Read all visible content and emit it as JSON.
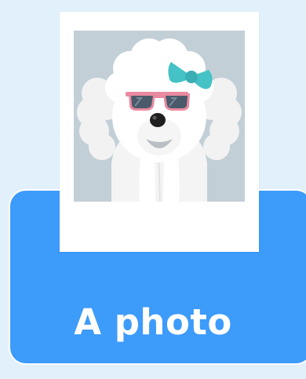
{
  "caption": "A photo",
  "photo": {
    "subject_icon": "poodle-with-sunglasses-and-bow-icon"
  },
  "colors": {
    "page_background": "#e1f0fa",
    "card_background": "#3d9bfa",
    "photo_background": "#c3cfd7",
    "bow": "#45c2c6",
    "sunglasses_frame": "#e98aa0",
    "lens": "#4a5a6a"
  }
}
